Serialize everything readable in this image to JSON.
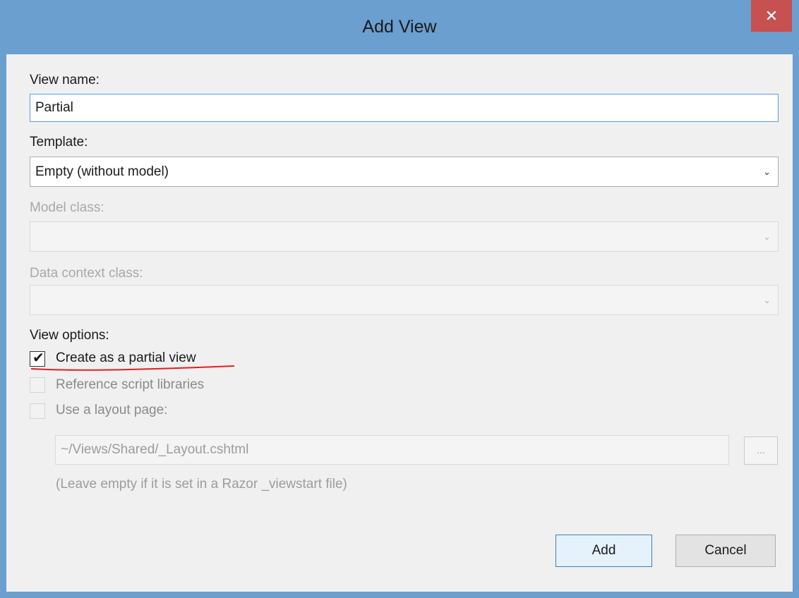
{
  "window": {
    "title": "Add View",
    "close_label": "✕"
  },
  "view_name": {
    "label": "View name:",
    "value": "Partial"
  },
  "template": {
    "label": "Template:",
    "value": "Empty (without model)"
  },
  "model_class": {
    "label": "Model class:",
    "value": ""
  },
  "data_context_class": {
    "label": "Data context class:",
    "value": ""
  },
  "view_options": {
    "label": "View options:",
    "partial_view": {
      "label": "Create as a partial view",
      "checked": true,
      "enabled": true
    },
    "reference_scripts": {
      "label": "Reference script libraries",
      "checked": false,
      "enabled": false
    },
    "layout_page": {
      "label": "Use a layout page:",
      "checked": false,
      "enabled": false
    }
  },
  "layout_path": {
    "value": "~/Views/Shared/_Layout.cshtml",
    "browse_label": "...",
    "hint": "(Leave empty if it is set in a Razor _viewstart file)"
  },
  "buttons": {
    "add": "Add",
    "cancel": "Cancel"
  },
  "colors": {
    "titlebar": "#6a9fd0",
    "close": "#c75050",
    "annotation": "#e02020"
  },
  "icons": {
    "dropdown": "chevron-down-icon",
    "check": "checkmark-icon",
    "close": "close-icon"
  }
}
